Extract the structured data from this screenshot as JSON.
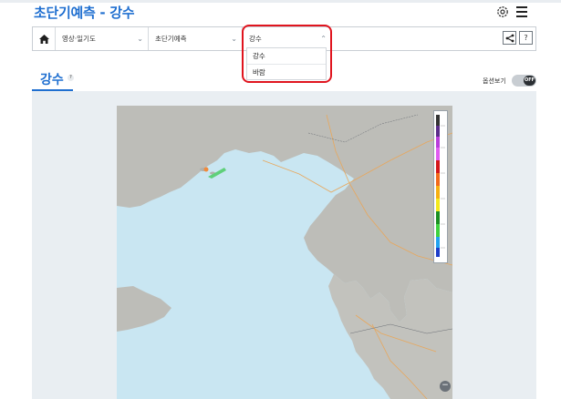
{
  "header": {
    "title": "초단기예측 - 강수"
  },
  "nav": {
    "select1": {
      "value": "영상·일기도"
    },
    "select2": {
      "value": "초단기예측"
    },
    "select3": {
      "value": "강수"
    },
    "help_label": "?"
  },
  "dropdown": {
    "options": [
      "강수",
      "바람"
    ]
  },
  "tab": {
    "title": "강수",
    "help_badge": "?"
  },
  "options": {
    "label": "옵션보기",
    "toggle_state": "OFF"
  },
  "map": {
    "zoom_label": "−"
  },
  "colors": {
    "accent": "#1f6fd0",
    "highlight": "#e0141e",
    "sea": "#c9e6f2"
  }
}
